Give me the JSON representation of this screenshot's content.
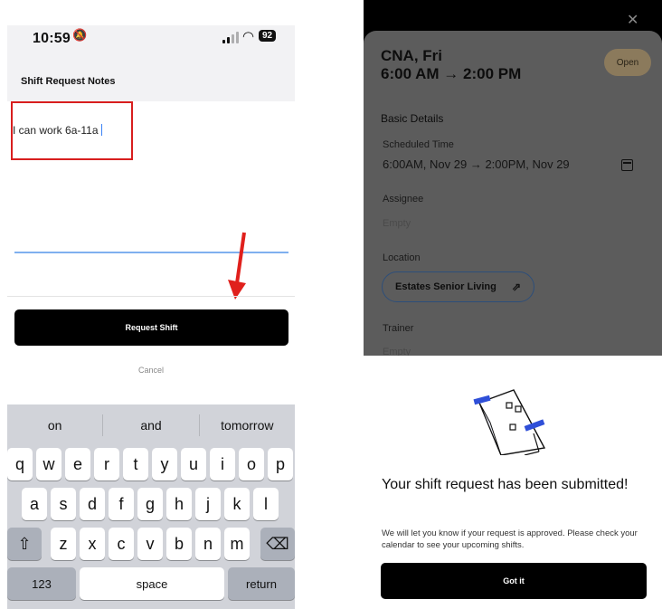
{
  "left": {
    "status": {
      "time": "10:59",
      "battery": "92"
    },
    "notes_title": "Shift Request Notes",
    "note_text": "I can work 6a-11a",
    "request_button": "Request Shift",
    "cancel": "Cancel",
    "keyboard": {
      "suggestions": [
        "on",
        "and",
        "tomorrow"
      ],
      "row1": [
        "q",
        "w",
        "e",
        "r",
        "t",
        "y",
        "u",
        "i",
        "o",
        "p"
      ],
      "row2": [
        "a",
        "s",
        "d",
        "f",
        "g",
        "h",
        "j",
        "k",
        "l"
      ],
      "row3": [
        "z",
        "x",
        "c",
        "v",
        "b",
        "n",
        "m"
      ],
      "numbers": "123",
      "space": "space",
      "return": "return"
    },
    "colors": {
      "highlight": "#d81e1e",
      "arrow": "#e0201c",
      "accent": "#3b82f6"
    }
  },
  "right": {
    "title_line1": "CNA, Fri",
    "title_line2": "6:00 AM → 2:00 PM",
    "status_badge": "Open",
    "basic_details": "Basic Details",
    "scheduled_time_label": "Scheduled Time",
    "scheduled_time_value": "6:00AM, Nov 29 → 2:00PM, Nov 29",
    "assignee_label": "Assignee",
    "assignee_value": "Empty",
    "location_label": "Location",
    "location_value": "Estates Senior Living",
    "trainer_label": "Trainer",
    "trainer_value": "Empty",
    "modal_title": "Your shift request has been submitted!",
    "modal_body": "We will let you know if your request is approved. Please check your calendar to see your upcoming shifts.",
    "got_it": "Got it"
  }
}
